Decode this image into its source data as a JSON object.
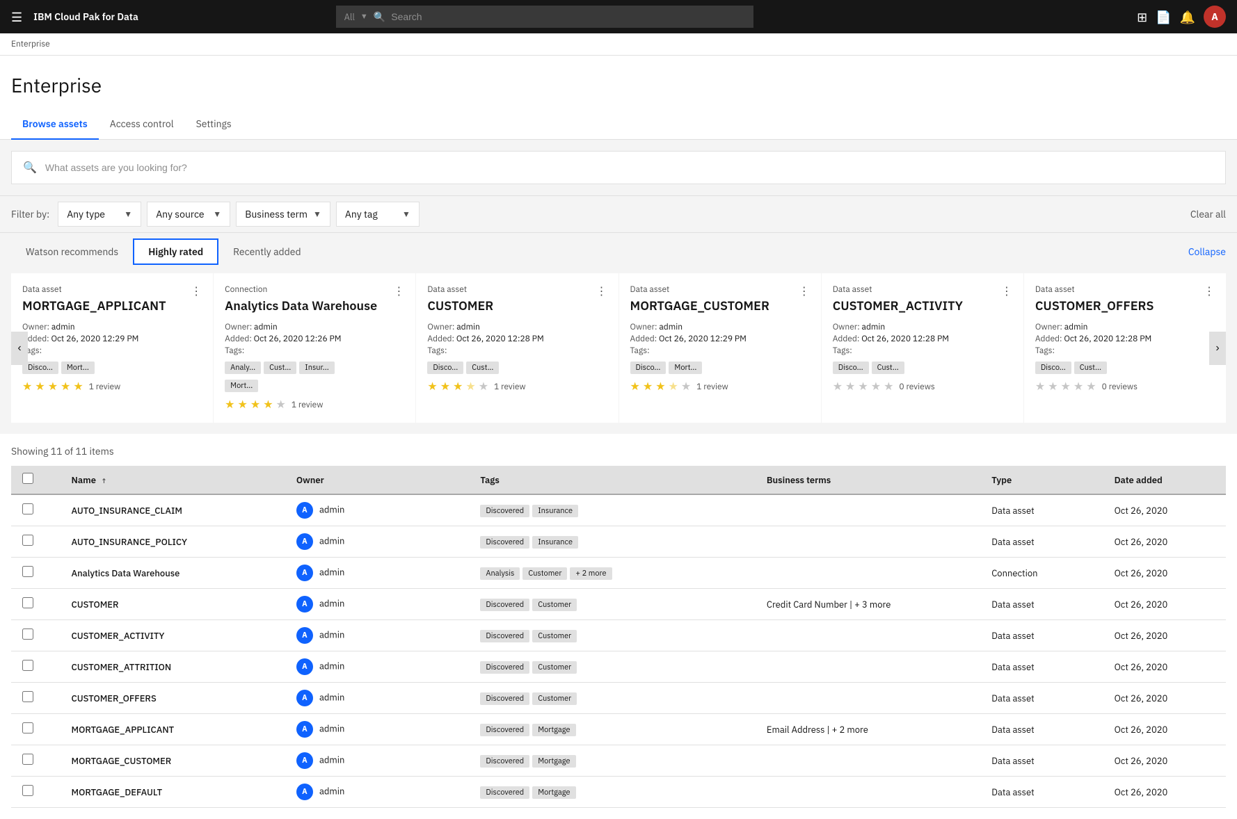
{
  "topnav": {
    "title": "IBM Cloud Pak for Data",
    "search_placeholder": "Search",
    "search_label": "All",
    "avatar_letter": "A"
  },
  "breadcrumb": "Enterprise",
  "page": {
    "title": "Enterprise",
    "tabs": [
      {
        "label": "Browse assets",
        "active": true
      },
      {
        "label": "Access control",
        "active": false
      },
      {
        "label": "Settings",
        "active": false
      }
    ]
  },
  "search": {
    "placeholder": "What assets are you looking for?"
  },
  "filters": {
    "label": "Filter by:",
    "type": {
      "value": "Any type",
      "options": [
        "Any type"
      ]
    },
    "source": {
      "value": "Any source",
      "options": [
        "Any source"
      ]
    },
    "term": {
      "value": "Business term",
      "options": [
        "Business term"
      ]
    },
    "tag": {
      "value": "Any tag",
      "options": [
        "Any tag"
      ]
    },
    "clear_label": "Clear all"
  },
  "card_section": {
    "tabs": [
      {
        "label": "Watson recommends",
        "active": false
      },
      {
        "label": "Highly rated",
        "active": true
      },
      {
        "label": "Recently added",
        "active": false
      }
    ],
    "collapse_label": "Collapse",
    "cards": [
      {
        "type": "Data asset",
        "name": "MORTGAGE_APPLICANT",
        "owner": "admin",
        "added": "Oct 26, 2020 12:29 PM",
        "tags": [
          "Disco...",
          "Mort..."
        ],
        "stars": 5,
        "reviews": "1 review"
      },
      {
        "type": "Connection",
        "name": "Analytics Data Warehouse",
        "owner": "admin",
        "added": "Oct 26, 2020 12:26 PM",
        "tags": [
          "Analy...",
          "Cust...",
          "Insur..."
        ],
        "extra_tag": "Mort...",
        "stars": 4,
        "reviews": "1 review"
      },
      {
        "type": "Data asset",
        "name": "CUSTOMER",
        "owner": "admin",
        "added": "Oct 26, 2020 12:28 PM",
        "tags": [
          "Disco...",
          "Cust..."
        ],
        "stars": 3.5,
        "reviews": "1 review"
      },
      {
        "type": "Data asset",
        "name": "MORTGAGE_CUSTOMER",
        "owner": "admin",
        "added": "Oct 26, 2020 12:29 PM",
        "tags": [
          "Disco...",
          "Mort..."
        ],
        "stars": 3.5,
        "reviews": "1 review"
      },
      {
        "type": "Data asset",
        "name": "CUSTOMER_ACTIVITY",
        "owner": "admin",
        "added": "Oct 26, 2020 12:28 PM",
        "tags": [
          "Disco...",
          "Cust..."
        ],
        "stars": 0,
        "reviews": "0 reviews"
      },
      {
        "type": "Data asset",
        "name": "CUSTOMER_OFFERS",
        "owner": "admin",
        "added": "Oct 26, 2020 12:28 PM",
        "tags": [
          "Disco...",
          "Cust..."
        ],
        "stars": 0,
        "reviews": "0 reviews"
      }
    ]
  },
  "table": {
    "count_label": "Showing 11 of 11 items",
    "columns": [
      "Name",
      "Owner",
      "Tags",
      "Business terms",
      "Type",
      "Date added"
    ],
    "rows": [
      {
        "name": "AUTO_INSURANCE_CLAIM",
        "owner": "admin",
        "tags": [
          "Discovered",
          "Insurance"
        ],
        "business_terms": "",
        "type": "Data asset",
        "date": "Oct 26, 2020"
      },
      {
        "name": "AUTO_INSURANCE_POLICY",
        "owner": "admin",
        "tags": [
          "Discovered",
          "Insurance"
        ],
        "business_terms": "",
        "type": "Data asset",
        "date": "Oct 26, 2020"
      },
      {
        "name": "Analytics Data Warehouse",
        "owner": "admin",
        "tags": [
          "Analysis",
          "Customer",
          "+ 2 more"
        ],
        "business_terms": "",
        "type": "Connection",
        "date": "Oct 26, 2020"
      },
      {
        "name": "CUSTOMER",
        "owner": "admin",
        "tags": [
          "Discovered",
          "Customer"
        ],
        "business_terms": "Credit Card Number | + 3 more",
        "type": "Data asset",
        "date": "Oct 26, 2020"
      },
      {
        "name": "CUSTOMER_ACTIVITY",
        "owner": "admin",
        "tags": [
          "Discovered",
          "Customer"
        ],
        "business_terms": "",
        "type": "Data asset",
        "date": "Oct 26, 2020"
      },
      {
        "name": "CUSTOMER_ATTRITION",
        "owner": "admin",
        "tags": [
          "Discovered",
          "Customer"
        ],
        "business_terms": "",
        "type": "Data asset",
        "date": "Oct 26, 2020"
      },
      {
        "name": "CUSTOMER_OFFERS",
        "owner": "admin",
        "tags": [
          "Discovered",
          "Customer"
        ],
        "business_terms": "",
        "type": "Data asset",
        "date": "Oct 26, 2020"
      },
      {
        "name": "MORTGAGE_APPLICANT",
        "owner": "admin",
        "tags": [
          "Discovered",
          "Mortgage"
        ],
        "business_terms": "Email Address | + 2 more",
        "type": "Data asset",
        "date": "Oct 26, 2020"
      },
      {
        "name": "MORTGAGE_CUSTOMER",
        "owner": "admin",
        "tags": [
          "Discovered",
          "Mortgage"
        ],
        "business_terms": "",
        "type": "Data asset",
        "date": "Oct 26, 2020"
      },
      {
        "name": "MORTGAGE_DEFAULT",
        "owner": "admin",
        "tags": [
          "Discovered",
          "Mortgage"
        ],
        "business_terms": "",
        "type": "Data asset",
        "date": "Oct 26, 2020"
      }
    ]
  }
}
